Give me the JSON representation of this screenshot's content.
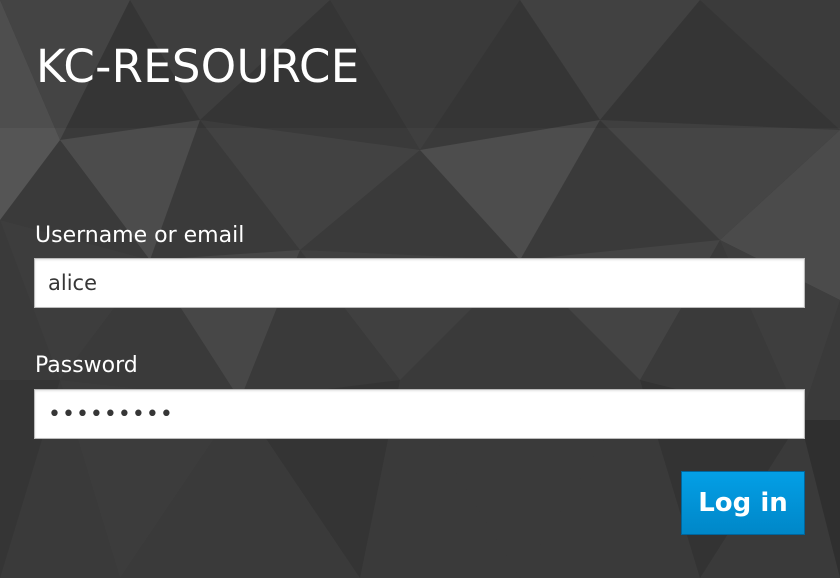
{
  "app": {
    "title": "KC-RESOURCE"
  },
  "login_form": {
    "username_label": "Username or email",
    "username_value": "alice",
    "password_label": "Password",
    "password_value": "•••••••••",
    "submit_label": "Log in"
  },
  "colors": {
    "background": "#3b3b3b",
    "text": "#ffffff",
    "primary_button": "#0088ce",
    "input_background": "#ffffff"
  }
}
